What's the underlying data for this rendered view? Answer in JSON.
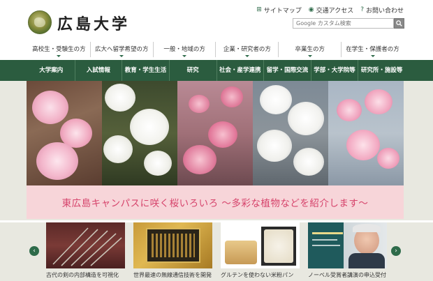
{
  "header": {
    "logo_text": "広島大学",
    "util_links": [
      {
        "icon": "sitemap-icon",
        "glyph": "⊞",
        "label": "サイトマップ"
      },
      {
        "icon": "location-pin-icon",
        "glyph": "◉",
        "label": "交通アクセス"
      },
      {
        "icon": "question-icon",
        "glyph": "?",
        "label": "お問い合わせ"
      }
    ],
    "search": {
      "placeholder": "Google カスタム検索"
    }
  },
  "audience_nav": [
    "高校生・受験生の方",
    "広大へ留学希望の方",
    "一般・地域の方",
    "企業・研究者の方",
    "卒業生の方",
    "在学生・保護者の方"
  ],
  "main_nav": [
    "大学案内",
    "入試情報",
    "教育・学生生活",
    "研究",
    "社会・産学連携",
    "留学・国際交流",
    "学部・大学院等",
    "研究所・施設等"
  ],
  "hero": {
    "caption": "東広島キャンパスに咲く桜いろいろ 〜多彩な植物などを紹介します〜"
  },
  "carousel": {
    "prev_glyph": "‹",
    "next_glyph": "›",
    "items": [
      {
        "title": "古代の剣の内部構造を可視化"
      },
      {
        "title": "世界最速の無線通信技術を開発"
      },
      {
        "title": "グルテンを使わない米粉パン"
      },
      {
        "title": "ノーベル受賞者講演の申込受付"
      }
    ]
  },
  "colors": {
    "brand_green": "#2b5c3f",
    "caption_pink": "#d6436b",
    "banner_pink": "#f7d5d9"
  }
}
